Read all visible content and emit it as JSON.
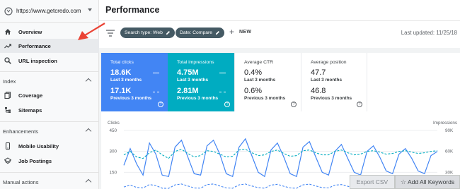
{
  "property": {
    "url": "https://www.getcredo.com"
  },
  "header": {
    "title": "Performance"
  },
  "sidebar": {
    "items": [
      {
        "label": "Overview",
        "icon": "home-icon"
      },
      {
        "label": "Performance",
        "icon": "trending-up-icon",
        "active": true
      },
      {
        "label": "URL inspection",
        "icon": "search-icon"
      }
    ],
    "sections": [
      {
        "title": "Index",
        "items": [
          {
            "label": "Coverage",
            "icon": "coverage-icon"
          },
          {
            "label": "Sitemaps",
            "icon": "sitemap-icon"
          }
        ]
      },
      {
        "title": "Enhancements",
        "items": [
          {
            "label": "Mobile Usability",
            "icon": "phone-icon"
          },
          {
            "label": "Job Postings",
            "icon": "layers-icon"
          }
        ]
      },
      {
        "title": "Manual actions",
        "items": []
      }
    ]
  },
  "filters": {
    "chips": [
      "Search type: Web",
      "Date: Compare"
    ],
    "new_label": "NEW",
    "last_updated": "Last updated: 11/25/18"
  },
  "metrics": [
    {
      "title": "Total clicks",
      "value": "18.6K",
      "period": "Last 3 months",
      "prev_value": "17.1K",
      "prev_period": "Previous 3 months"
    },
    {
      "title": "Total impressions",
      "value": "4.75M",
      "period": "Last 3 months",
      "prev_value": "2.81M",
      "prev_period": "Previous 3 months"
    },
    {
      "title": "Average CTR",
      "value": "0.4%",
      "period": "Last 3 months",
      "prev_value": "0.6%",
      "prev_period": "Previous 3 months"
    },
    {
      "title": "Average position",
      "value": "47.7",
      "period": "Last 3 months",
      "prev_value": "46.8",
      "prev_period": "Previous 3 months"
    }
  ],
  "actions": {
    "export": "Export CSV",
    "add_all": "Add All Keywords"
  },
  "colors": {
    "clicks": "#4285f4",
    "impressions": "#00acc1",
    "chip": "#455a64",
    "arrow": "#ea4335"
  },
  "chart_data": {
    "type": "line",
    "left_axis": {
      "label": "Clicks",
      "ticks": [
        450,
        300,
        150
      ],
      "ylim": [
        0,
        450
      ]
    },
    "right_axis": {
      "label": "Impressions",
      "ticks": [
        "90K",
        "60K",
        "30K"
      ],
      "ylim": [
        0,
        90000
      ]
    },
    "series": [
      {
        "values": [
          290,
          330,
          250,
          220,
          340,
          300,
          180,
          160,
          320,
          350,
          300,
          200,
          170,
          280,
          340,
          310,
          200,
          160,
          300,
          350,
          320,
          230,
          180,
          260,
          340,
          300,
          210,
          160,
          300,
          330,
          290,
          200,
          170,
          260,
          330,
          300,
          220,
          180,
          250,
          320,
          300,
          230,
          190,
          270,
          300,
          280,
          230,
          200,
          260,
          290
        ]
      },
      {
        "values": [
          200,
          320,
          210,
          130,
          360,
          280,
          130,
          120,
          330,
          380,
          260,
          140,
          130,
          340,
          380,
          280,
          140,
          120,
          330,
          390,
          270,
          150,
          120,
          310,
          360,
          260,
          140,
          120,
          330,
          370,
          260,
          150,
          130,
          300,
          350,
          250,
          150,
          130,
          300,
          340,
          260,
          160,
          140,
          280,
          320,
          250,
          160,
          140,
          270,
          300
        ]
      },
      {
        "values": [
          55,
          60,
          52,
          50,
          58,
          62,
          55,
          50,
          60,
          63,
          57,
          52,
          54,
          61,
          60,
          56,
          52,
          53,
          62,
          63,
          58,
          54,
          55,
          60,
          62,
          57,
          53,
          54,
          61,
          62,
          58,
          55,
          55,
          60,
          62,
          58,
          55,
          56,
          60,
          61,
          59,
          56,
          57,
          60,
          61,
          59,
          57,
          58,
          60,
          61
        ]
      },
      {
        "values": [
          45,
          58,
          42,
          38,
          62,
          55,
          36,
          35,
          60,
          66,
          52,
          38,
          36,
          62,
          66,
          52,
          38,
          36,
          60,
          66,
          52,
          40,
          36,
          58,
          64,
          50,
          38,
          36,
          60,
          65,
          52,
          40,
          38,
          58,
          62,
          50,
          40,
          38,
          56,
          62,
          52,
          42,
          40,
          56,
          60,
          52,
          42,
          40,
          55,
          58
        ]
      }
    ]
  }
}
